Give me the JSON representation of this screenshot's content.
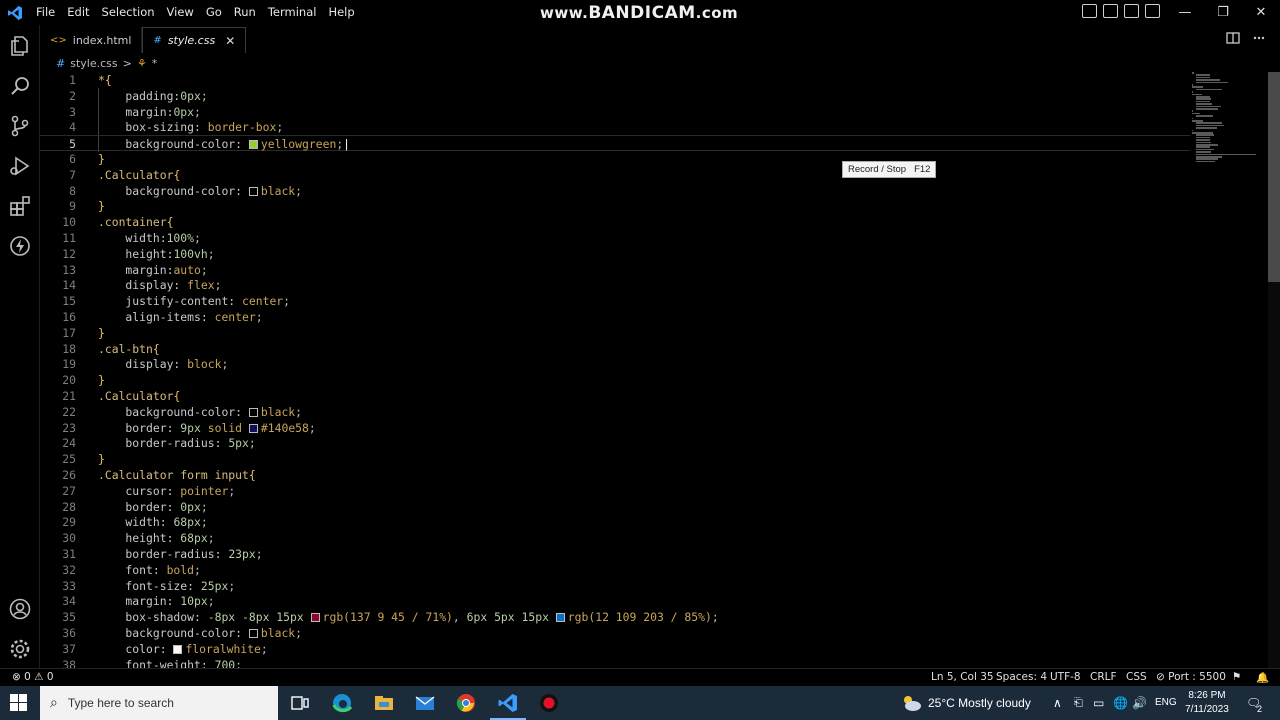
{
  "titlebar": {
    "menu": [
      "File",
      "Edit",
      "Selection",
      "View",
      "Go",
      "Run",
      "Terminal",
      "Help"
    ],
    "watermark_prefix": "www.",
    "watermark_brand": "BANDICAM",
    "watermark_suffix": ".com",
    "window_controls": [
      "—",
      "❐",
      "✕"
    ]
  },
  "tabs": [
    {
      "icon": "<>",
      "label": "index.html",
      "active": false
    },
    {
      "icon": "#",
      "label": "style.css",
      "active": true,
      "close": "✕"
    }
  ],
  "breadcrumb": {
    "file": "style.css",
    "separator": ">",
    "symbol": "*"
  },
  "tooltip": {
    "label": "Record / Stop",
    "key": "F12"
  },
  "status": {
    "problems": "⊗ 0 ⚠ 0",
    "position": "Ln 5, Col 35",
    "spaces": "Spaces: 4",
    "encoding": "UTF-8",
    "eol": "CRLF",
    "language": "CSS",
    "port": "⊘ Port : 5500"
  },
  "taskbar": {
    "search_placeholder": "Type here to search",
    "weather": "25°C  Mostly cloudy",
    "lang": "ENG",
    "time": "8:26 PM",
    "date": "7/11/2023",
    "notifications": "2"
  },
  "colors": {
    "yellowgreen": "#9acd32",
    "black": "#000000",
    "border_color": "#140e58",
    "shadow1": "#89092d",
    "shadow2": "#0c6dcb",
    "floralwhite": "#fffaf0"
  },
  "code_lines": [
    {
      "n": "1",
      "t": [
        [
          "brace",
          "*{"
        ]
      ]
    },
    {
      "n": "2",
      "t": [
        [
          "prop",
          "    padding:"
        ],
        [
          "num",
          "0px"
        ],
        [
          "punc",
          ";"
        ]
      ]
    },
    {
      "n": "3",
      "t": [
        [
          "prop",
          "    margin:"
        ],
        [
          "num",
          "0px"
        ],
        [
          "punc",
          ";"
        ]
      ]
    },
    {
      "n": "4",
      "t": [
        [
          "prop",
          "    box-sizing: "
        ],
        [
          "val",
          "border-box"
        ],
        [
          "punc",
          ";"
        ]
      ]
    },
    {
      "n": "5",
      "current": true,
      "t": [
        [
          "prop",
          "    background-color: "
        ],
        [
          "swatch",
          "#9acd32"
        ],
        [
          "val",
          "yellowgreen"
        ],
        [
          "punc",
          ";"
        ]
      ]
    },
    {
      "n": "6",
      "t": [
        [
          "brace",
          "}"
        ]
      ]
    },
    {
      "n": "7",
      "t": [
        [
          "sel",
          ".Calculator"
        ],
        [
          "brace",
          "{"
        ]
      ]
    },
    {
      "n": "8",
      "t": [
        [
          "prop",
          "    background-color: "
        ],
        [
          "swatch",
          "#000000"
        ],
        [
          "val",
          "black"
        ],
        [
          "punc",
          ";"
        ]
      ]
    },
    {
      "n": "9",
      "t": [
        [
          "brace",
          "}"
        ]
      ]
    },
    {
      "n": "10",
      "t": [
        [
          "sel",
          ".container"
        ],
        [
          "brace",
          "{"
        ]
      ]
    },
    {
      "n": "11",
      "t": [
        [
          "prop",
          "    width:"
        ],
        [
          "num",
          "100%"
        ],
        [
          "punc",
          ";"
        ]
      ]
    },
    {
      "n": "12",
      "t": [
        [
          "prop",
          "    height:"
        ],
        [
          "num",
          "100vh"
        ],
        [
          "punc",
          ";"
        ]
      ]
    },
    {
      "n": "13",
      "t": [
        [
          "prop",
          "    margin:"
        ],
        [
          "val",
          "auto"
        ],
        [
          "punc",
          ";"
        ]
      ]
    },
    {
      "n": "14",
      "t": [
        [
          "prop",
          "    display: "
        ],
        [
          "val",
          "flex"
        ],
        [
          "punc",
          ";"
        ]
      ]
    },
    {
      "n": "15",
      "t": [
        [
          "prop",
          "    justify-content: "
        ],
        [
          "val",
          "center"
        ],
        [
          "punc",
          ";"
        ]
      ]
    },
    {
      "n": "16",
      "t": [
        [
          "prop",
          "    align-items: "
        ],
        [
          "val",
          "center"
        ],
        [
          "punc",
          ";"
        ]
      ]
    },
    {
      "n": "17",
      "t": [
        [
          "brace",
          "}"
        ]
      ]
    },
    {
      "n": "18",
      "t": [
        [
          "sel",
          ".cal-btn"
        ],
        [
          "brace",
          "{"
        ]
      ]
    },
    {
      "n": "19",
      "t": [
        [
          "prop",
          "    display: "
        ],
        [
          "val",
          "block"
        ],
        [
          "punc",
          ";"
        ]
      ]
    },
    {
      "n": "20",
      "t": [
        [
          "brace",
          "}"
        ]
      ]
    },
    {
      "n": "21",
      "t": [
        [
          "sel",
          ".Calculator"
        ],
        [
          "brace",
          "{"
        ]
      ]
    },
    {
      "n": "22",
      "t": [
        [
          "prop",
          "    background-color: "
        ],
        [
          "swatch",
          "#000000"
        ],
        [
          "val",
          "black"
        ],
        [
          "punc",
          ";"
        ]
      ]
    },
    {
      "n": "23",
      "t": [
        [
          "prop",
          "    border: "
        ],
        [
          "num",
          "9px"
        ],
        [
          "val",
          " solid "
        ],
        [
          "swatch",
          "#140e58"
        ],
        [
          "val",
          "#140e58"
        ],
        [
          "punc",
          ";"
        ]
      ]
    },
    {
      "n": "24",
      "t": [
        [
          "prop",
          "    border-radius: "
        ],
        [
          "num",
          "5px"
        ],
        [
          "punc",
          ";"
        ]
      ]
    },
    {
      "n": "25",
      "t": [
        [
          "brace",
          "}"
        ]
      ]
    },
    {
      "n": "26",
      "t": [
        [
          "sel",
          ".Calculator form input"
        ],
        [
          "brace",
          "{"
        ]
      ]
    },
    {
      "n": "27",
      "t": [
        [
          "prop",
          "    cursor: "
        ],
        [
          "val",
          "pointer"
        ],
        [
          "punc",
          ";"
        ]
      ]
    },
    {
      "n": "28",
      "t": [
        [
          "prop",
          "    border: "
        ],
        [
          "num",
          "0px"
        ],
        [
          "punc",
          ";"
        ]
      ]
    },
    {
      "n": "29",
      "t": [
        [
          "prop",
          "    width: "
        ],
        [
          "num",
          "68px"
        ],
        [
          "punc",
          ";"
        ]
      ]
    },
    {
      "n": "30",
      "t": [
        [
          "prop",
          "    height: "
        ],
        [
          "num",
          "68px"
        ],
        [
          "punc",
          ";"
        ]
      ]
    },
    {
      "n": "31",
      "t": [
        [
          "prop",
          "    border-radius: "
        ],
        [
          "num",
          "23px"
        ],
        [
          "punc",
          ";"
        ]
      ]
    },
    {
      "n": "32",
      "t": [
        [
          "prop",
          "    font: "
        ],
        [
          "val",
          "bold"
        ],
        [
          "punc",
          ";"
        ]
      ]
    },
    {
      "n": "33",
      "t": [
        [
          "prop",
          "    font-size: "
        ],
        [
          "num",
          "25px"
        ],
        [
          "punc",
          ";"
        ]
      ]
    },
    {
      "n": "34",
      "t": [
        [
          "prop",
          "    margin: "
        ],
        [
          "num",
          "10px"
        ],
        [
          "punc",
          ";"
        ]
      ]
    },
    {
      "n": "35",
      "t": [
        [
          "prop",
          "    box-shadow: "
        ],
        [
          "num",
          "-8px -8px 15px "
        ],
        [
          "swatch",
          "#89092d"
        ],
        [
          "val",
          "rgb(137 9 45 / 71%)"
        ],
        [
          "punc",
          ", "
        ],
        [
          "num",
          "6px 5px 15px "
        ],
        [
          "swatch",
          "#0c6dcb"
        ],
        [
          "val",
          "rgb(12 109 203 / 85%)"
        ],
        [
          "punc",
          ";"
        ]
      ]
    },
    {
      "n": "36",
      "t": [
        [
          "prop",
          "    background-color: "
        ],
        [
          "swatch",
          "#000000"
        ],
        [
          "val",
          "black"
        ],
        [
          "punc",
          ";"
        ]
      ]
    },
    {
      "n": "37",
      "t": [
        [
          "prop",
          "    color: "
        ],
        [
          "swatch",
          "#fffaf0"
        ],
        [
          "val",
          "floralwhite"
        ],
        [
          "punc",
          ";"
        ]
      ]
    },
    {
      "n": "38",
      "t": [
        [
          "prop",
          "    font-weight: "
        ],
        [
          "num",
          "700"
        ],
        [
          "punc",
          ";"
        ]
      ]
    }
  ]
}
